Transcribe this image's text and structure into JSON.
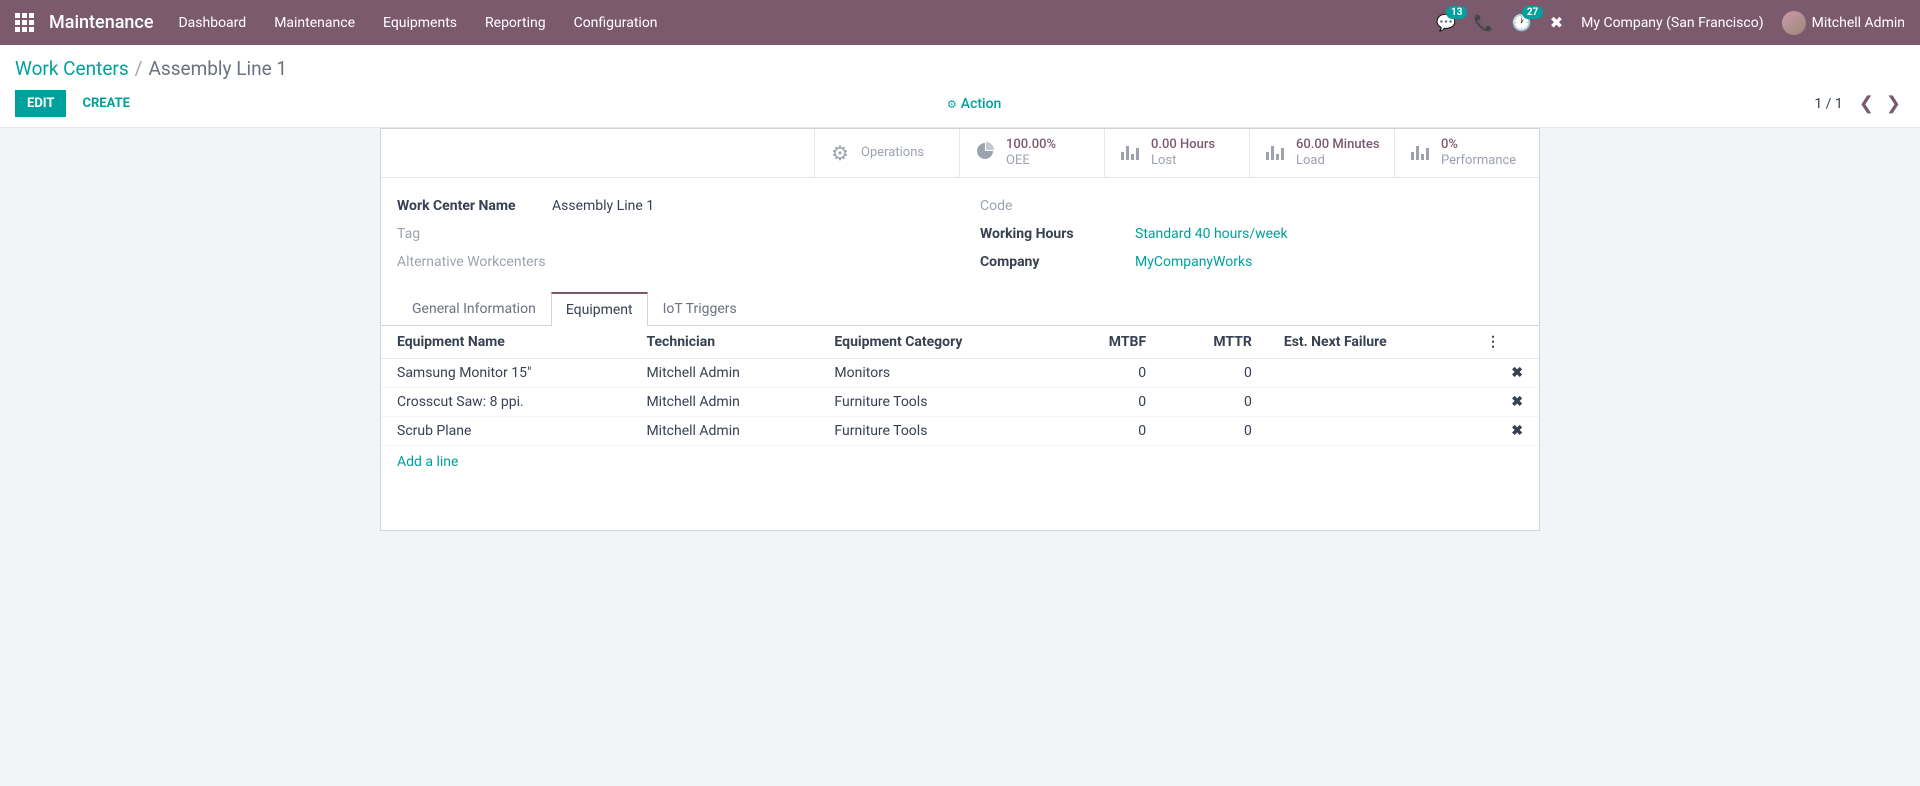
{
  "nav": {
    "app_title": "Maintenance",
    "menu": [
      "Dashboard",
      "Maintenance",
      "Equipments",
      "Reporting",
      "Configuration"
    ],
    "messages_badge": "13",
    "activities_badge": "27",
    "company": "My Company (San Francisco)",
    "user": "Mitchell Admin"
  },
  "breadcrumb": {
    "parent": "Work Centers",
    "current": "Assembly Line 1"
  },
  "buttons": {
    "edit": "EDIT",
    "create": "CREATE",
    "action": "Action"
  },
  "pager": {
    "text": "1 / 1"
  },
  "stats": {
    "operations": {
      "label": "Operations"
    },
    "oee": {
      "value": "100.00%",
      "label": "OEE"
    },
    "lost": {
      "value": "0.00 Hours",
      "label": "Lost"
    },
    "load": {
      "value": "60.00 Minutes",
      "label": "Load"
    },
    "perf": {
      "value": "0%",
      "label": "Performance"
    }
  },
  "fields": {
    "work_center_name": {
      "label": "Work Center Name",
      "value": "Assembly Line 1"
    },
    "tag": {
      "label": "Tag",
      "value": ""
    },
    "alt_workcenters": {
      "label": "Alternative Workcenters",
      "value": ""
    },
    "code": {
      "label": "Code",
      "value": ""
    },
    "working_hours": {
      "label": "Working Hours",
      "value": "Standard 40 hours/week"
    },
    "company": {
      "label": "Company",
      "value": "MyCompanyWorks"
    }
  },
  "tabs": {
    "general": "General Information",
    "equipment": "Equipment",
    "iot": "IoT Triggers"
  },
  "table": {
    "headers": {
      "name": "Equipment Name",
      "technician": "Technician",
      "category": "Equipment Category",
      "mtbf": "MTBF",
      "mttr": "MTTR",
      "next_failure": "Est. Next Failure"
    },
    "rows": [
      {
        "name": "Samsung Monitor 15\"",
        "technician": "Mitchell Admin",
        "category": "Monitors",
        "mtbf": "0",
        "mttr": "0",
        "next_failure": ""
      },
      {
        "name": "Crosscut Saw: 8 ppi.",
        "technician": "Mitchell Admin",
        "category": "Furniture Tools",
        "mtbf": "0",
        "mttr": "0",
        "next_failure": ""
      },
      {
        "name": "Scrub Plane",
        "technician": "Mitchell Admin",
        "category": "Furniture Tools",
        "mtbf": "0",
        "mttr": "0",
        "next_failure": ""
      }
    ],
    "add_line": "Add a line"
  }
}
